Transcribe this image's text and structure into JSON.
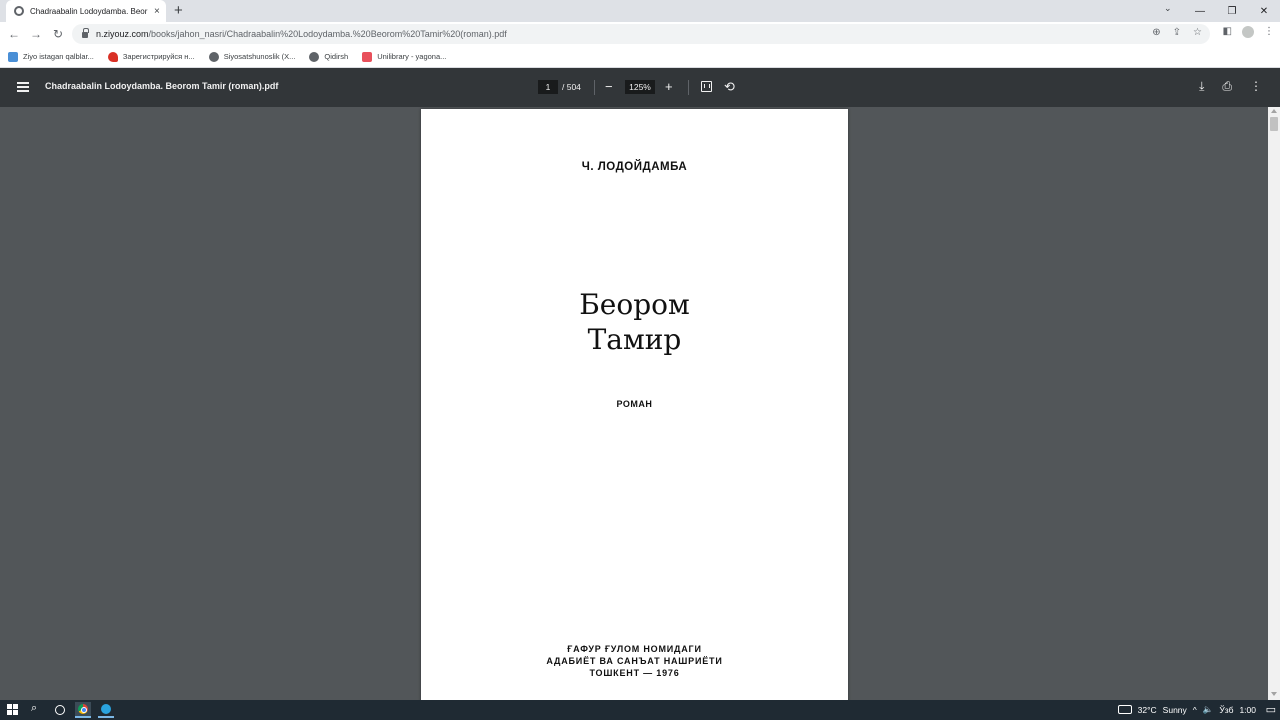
{
  "browser": {
    "tab": {
      "title": "Chadraabalin Lodoydamba. Beor",
      "close": "×"
    },
    "new_tab": "+",
    "window_controls": {
      "tab_search": "⌄",
      "minimize": "—",
      "restore": "❐",
      "close": "✕"
    },
    "nav": {
      "back": "←",
      "forward": "→",
      "reload": "↻"
    },
    "address": {
      "domain": "n.ziyouz.com",
      "path": "/books/jahon_nasri/Chadraabalin%20Lodoydamba.%20Beorom%20Tamir%20(roman).pdf"
    },
    "omnibox_icons": {
      "zoom": "⊕",
      "share": "⇪",
      "bookmark": "☆"
    },
    "toolbar_icons": {
      "sidebar": "◧",
      "menu": "⋮"
    },
    "bookmarks": [
      {
        "label": "Ziyo istagan qalblar...",
        "color": "#4a8fd6"
      },
      {
        "label": "Зарегистрируйся н...",
        "color": "#d93025"
      },
      {
        "label": "Siyosatshunoslik (X...",
        "color": "#5f6368"
      },
      {
        "label": "Qidirsh",
        "color": "#5f6368"
      },
      {
        "label": "Unilibrary - yagona...",
        "color": "#e8505b"
      }
    ]
  },
  "pdf_viewer": {
    "file_name": "Chadraabalin Lodoydamba. Beorom Tamir (roman).pdf",
    "current_page": "1",
    "page_total": "/ 504",
    "zoom_out": "−",
    "zoom_level": "125%",
    "zoom_in": "+",
    "rotate": "⟲",
    "download": "⤓",
    "print": "⎙",
    "more": "⋮"
  },
  "document_page": {
    "author": "Ч. ЛОДОЙДАМБА",
    "title_line1": "Беором",
    "title_line2": "Тамир",
    "genre": "РОМАН",
    "publisher_line1": "ҒАФУР ҒУЛОМ НОМИДАГИ",
    "publisher_line2": "АДАБИЁТ ВА САНЪАТ НАШРИЁТИ",
    "publisher_line3": "ТОШКЕНТ — 1976"
  },
  "taskbar": {
    "search": "⌕",
    "temperature": "32°C",
    "weather": "Sunny",
    "tray_arrow": "^",
    "volume": "🔈",
    "language": "Ўзб",
    "time": "1:00",
    "notifications": "▭"
  }
}
